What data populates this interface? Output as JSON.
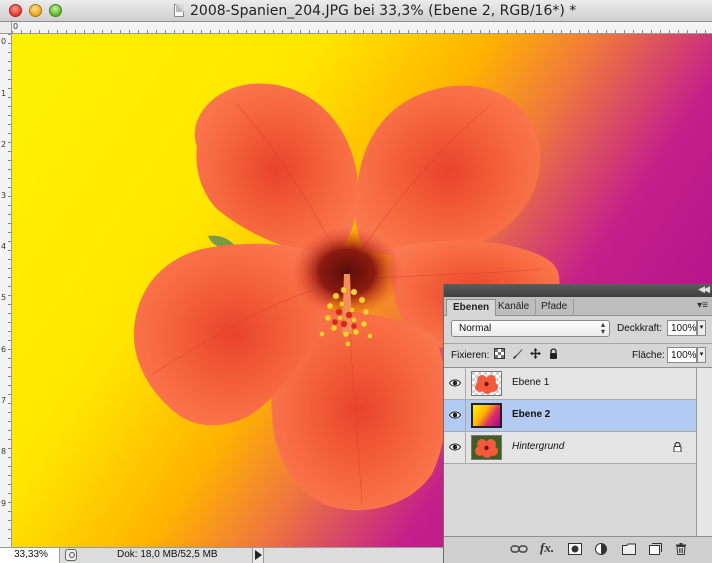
{
  "window": {
    "title": "2008-Spanien_204.JPG bei 33,3% (Ebene 2, RGB/16*) *"
  },
  "rulers": {
    "top_numbers": [
      "0"
    ],
    "left_numbers": [
      "0",
      "1",
      "2",
      "3",
      "4",
      "5",
      "6",
      "7",
      "8",
      "9"
    ]
  },
  "statusbar": {
    "zoom": "33,33%",
    "doc_info": "Dok: 18,0 MB/52,5 MB"
  },
  "layers_panel": {
    "tabs": [
      {
        "label": "Ebenen",
        "active": true
      },
      {
        "label": "Kanäle",
        "active": false
      },
      {
        "label": "Pfade",
        "active": false
      }
    ],
    "blend_mode": "Normal",
    "opacity_label": "Deckkraft:",
    "opacity_value": "100%",
    "lock_label": "Fixieren:",
    "fill_label": "Fläche:",
    "fill_value": "100%",
    "layers": [
      {
        "name": "Ebene 1",
        "visible": true,
        "selected": false,
        "locked": false,
        "thumb": "flower-on-transparent"
      },
      {
        "name": "Ebene 2",
        "visible": true,
        "selected": true,
        "locked": false,
        "thumb": "yellow-magenta-gradient"
      },
      {
        "name": "Hintergrund",
        "visible": true,
        "selected": false,
        "locked": true,
        "thumb": "flower-photo"
      }
    ],
    "footer_icons": [
      "link-layers-icon",
      "fx-icon",
      "mask-icon",
      "adjustment-icon",
      "group-folder-icon",
      "new-layer-icon",
      "trash-icon"
    ]
  },
  "colors": {
    "gradient_yellow": "#fff200",
    "gradient_orange": "#ffb300",
    "gradient_magenta": "#a3078e",
    "flower": "#f25a3c",
    "selection": "#b3cbf2"
  }
}
